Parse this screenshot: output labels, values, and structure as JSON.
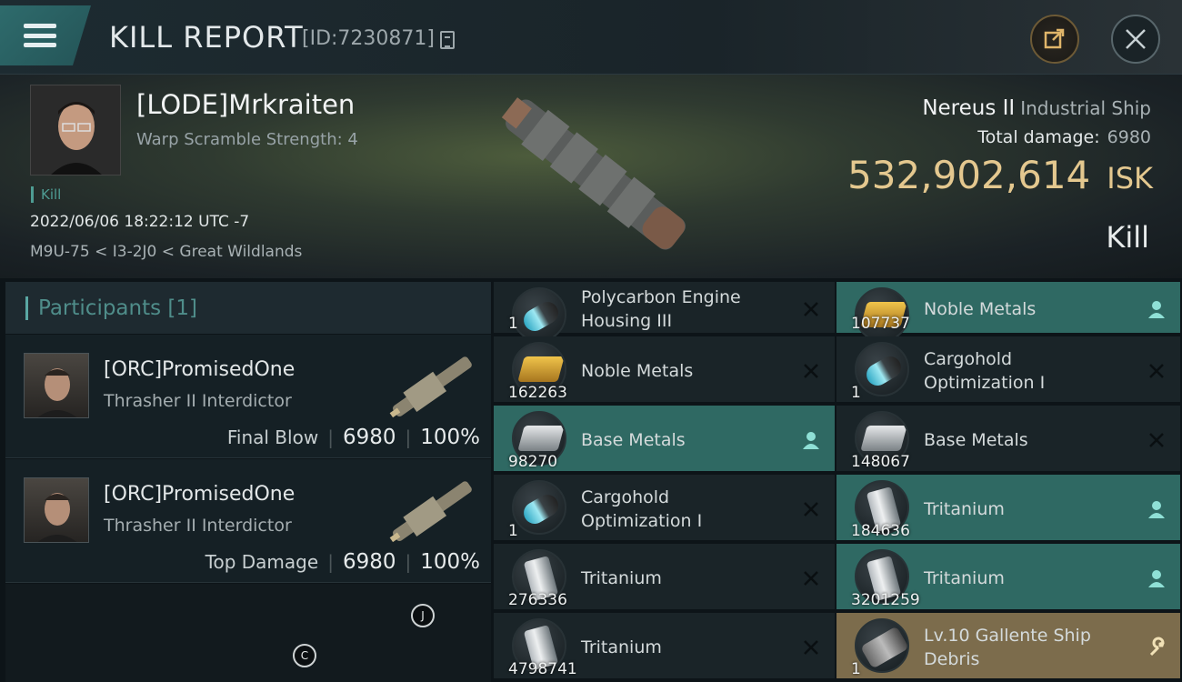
{
  "header": {
    "title": "KILL REPORT",
    "report_id": "[ID:7230871]"
  },
  "victim": {
    "name": "[LODE]Mrkraiten",
    "warp_scramble": "Warp Scramble Strength: 4",
    "tag": "Kill",
    "datetime": "2022/06/06 18:22:12 UTC -7",
    "location": "M9U-75 < I3-2J0 < Great Wildlands",
    "ship_name": "Nereus II",
    "ship_class": "Industrial Ship",
    "total_damage_label": "Total damage:",
    "total_damage": "6980",
    "isk_value": "532,902,614",
    "isk_unit": "ISK",
    "result": "Kill"
  },
  "participants": {
    "header": "Participants [1]",
    "list": [
      {
        "name": "[ORC]PromisedOne",
        "ship": "Thrasher II Interdictor",
        "label": "Final Blow",
        "damage": "6980",
        "percent": "100%"
      },
      {
        "name": "[ORC]PromisedOne",
        "ship": "Thrasher II Interdictor",
        "label": "Top Damage",
        "damage": "6980",
        "percent": "100%"
      }
    ]
  },
  "items": {
    "left": [
      {
        "name1": "Polycarbon Engine",
        "name2": "Housing III",
        "qty": "1",
        "icon": "module-icon",
        "status": "destroyed"
      },
      {
        "name1": "Noble Metals",
        "name2": "",
        "qty": "162263",
        "icon": "gold-ingot-icon",
        "status": "destroyed"
      },
      {
        "name1": "Base Metals",
        "name2": "",
        "qty": "98270",
        "icon": "silver-ingot-icon",
        "status": "dropped"
      },
      {
        "name1": "Cargohold",
        "name2": "Optimization I",
        "qty": "1",
        "icon": "module-icon",
        "status": "destroyed"
      },
      {
        "name1": "Tritanium",
        "name2": "",
        "qty": "276336",
        "icon": "tritanium-icon",
        "status": "destroyed"
      },
      {
        "name1": "Tritanium",
        "name2": "",
        "qty": "4798741",
        "icon": "tritanium-icon",
        "status": "destroyed"
      }
    ],
    "right": [
      {
        "name1": "Noble Metals",
        "name2": "",
        "qty": "107737",
        "icon": "gold-ingot-icon",
        "status": "dropped"
      },
      {
        "name1": "Cargohold",
        "name2": "Optimization I",
        "qty": "1",
        "icon": "module-icon",
        "status": "destroyed"
      },
      {
        "name1": "Base Metals",
        "name2": "",
        "qty": "148067",
        "icon": "silver-ingot-icon",
        "status": "destroyed"
      },
      {
        "name1": "Tritanium",
        "name2": "",
        "qty": "184636",
        "icon": "tritanium-icon",
        "status": "dropped"
      },
      {
        "name1": "Tritanium",
        "name2": "",
        "qty": "3201259",
        "icon": "tritanium-icon",
        "status": "dropped"
      },
      {
        "name1": "Lv.10 Gallente Ship",
        "name2": "Debris",
        "qty": "1",
        "icon": "debris-icon",
        "status": "special"
      }
    ]
  },
  "markers": {
    "j": "J",
    "c": "C"
  },
  "colors": {
    "dropped": "#2f6963",
    "special": "#7c6c4c",
    "isk": "#e4c88f",
    "accent": "#5aa7a3"
  }
}
